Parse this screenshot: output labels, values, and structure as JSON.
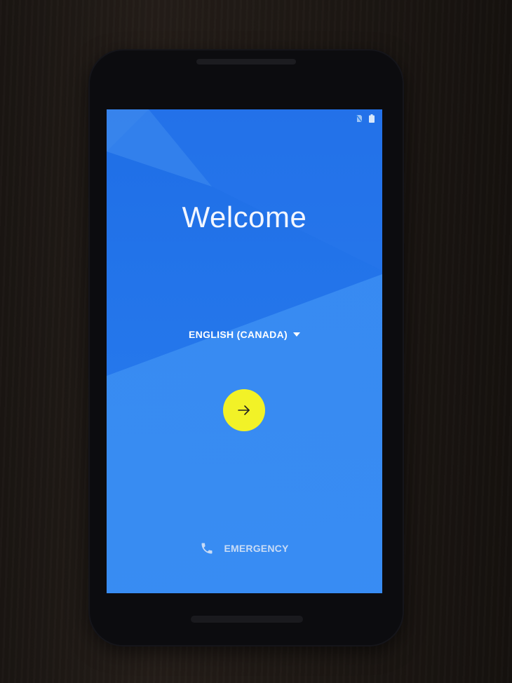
{
  "screen": {
    "title": "Welcome",
    "language_selector": {
      "label": "ENGLISH (CANADA)"
    },
    "next_button": {
      "icon": "arrow-right-icon"
    },
    "emergency": {
      "label": "EMERGENCY",
      "icon": "phone-icon"
    },
    "status_bar": {
      "icons": [
        "no-sim-icon",
        "battery-icon"
      ]
    }
  },
  "colors": {
    "screen_blue": "#2f86ee",
    "accent_yellow": "#f2f227",
    "text_white": "#f2f6ff"
  }
}
